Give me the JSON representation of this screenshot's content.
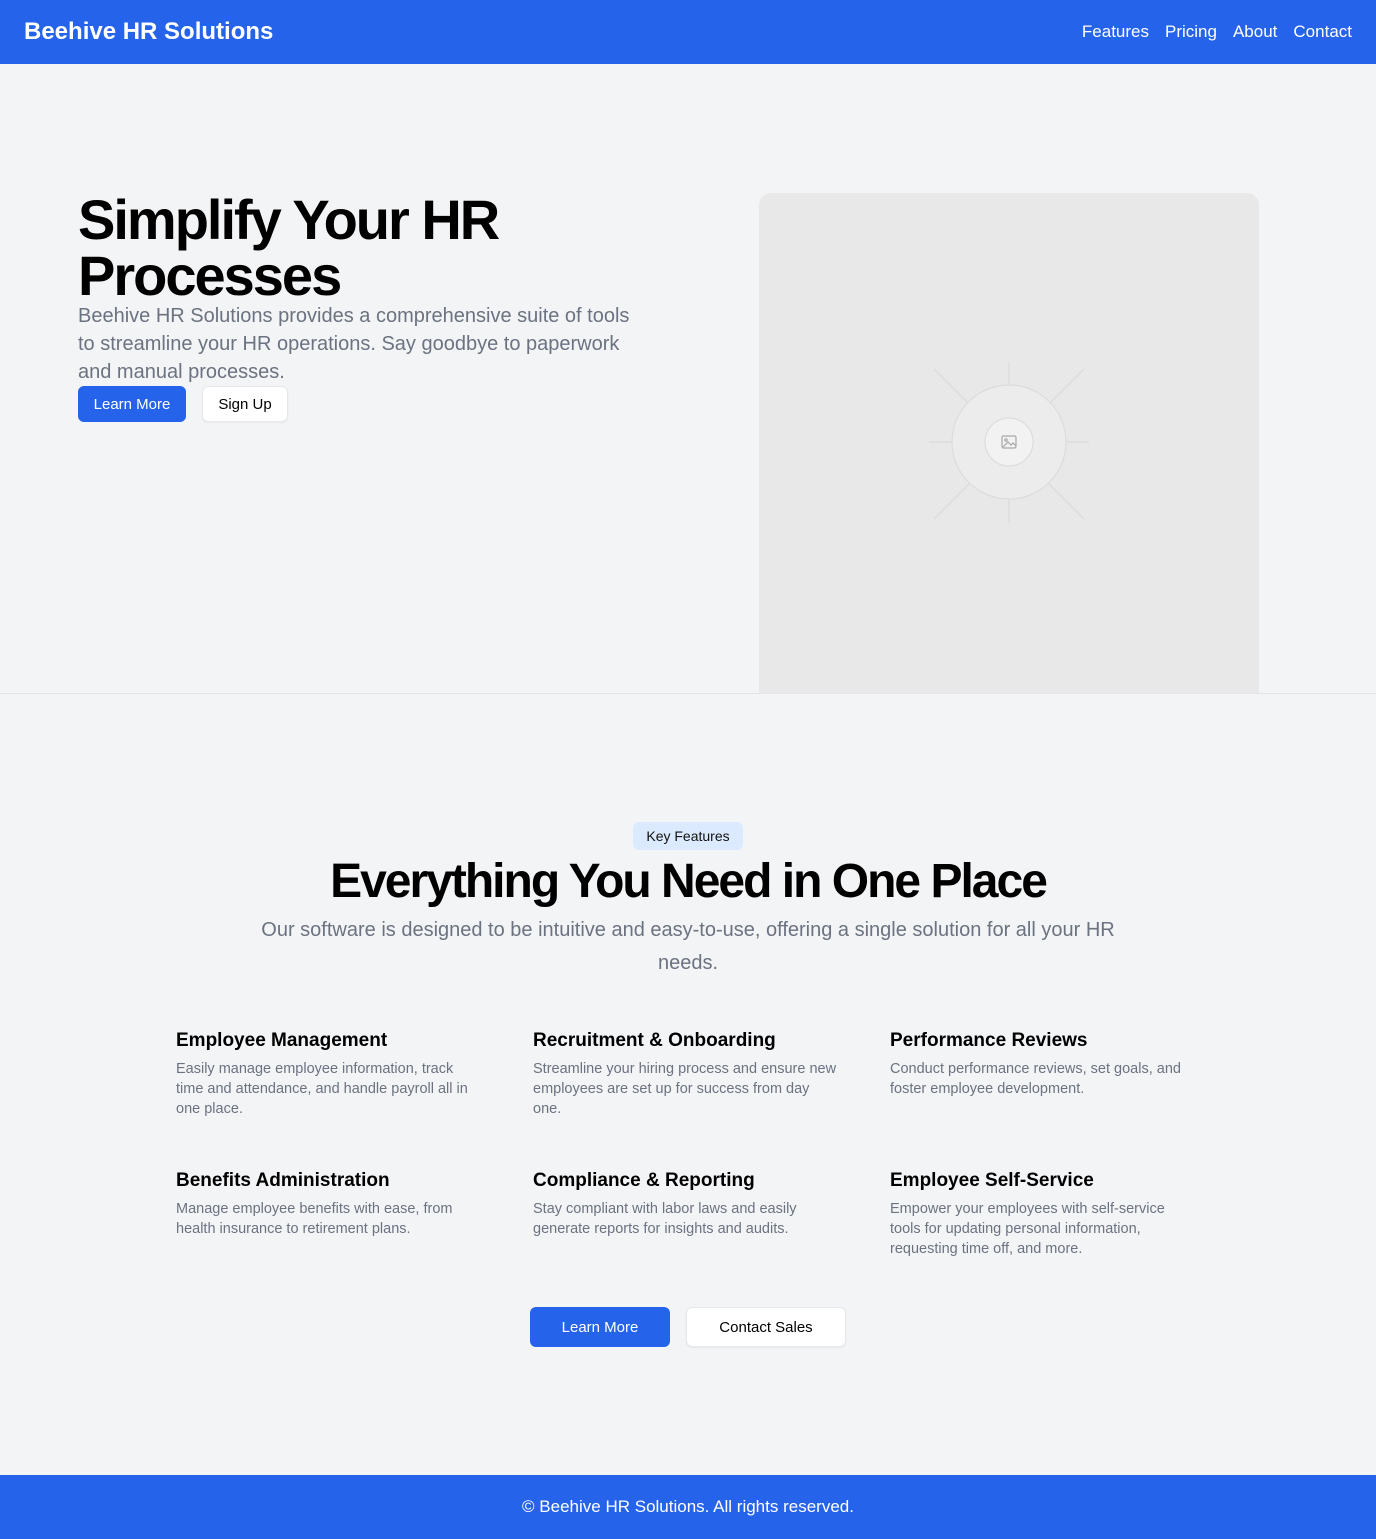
{
  "header": {
    "brand": "Beehive HR Solutions",
    "nav": [
      "Features",
      "Pricing",
      "About",
      "Contact"
    ]
  },
  "hero": {
    "title": "Simplify Your HR Processes",
    "subtitle": "Beehive HR Solutions provides a comprehensive suite of tools to streamline your HR operations. Say goodbye to paperwork and manual processes.",
    "primary_button": "Learn More",
    "secondary_button": "Sign Up",
    "image_icon": "image-placeholder-icon"
  },
  "features_section": {
    "badge": "Key Features",
    "title": "Everything You Need in One Place",
    "subtitle": "Our software is designed to be intuitive and easy-to-use, offering a single solution for all your HR needs.",
    "items": [
      {
        "title": "Employee Management",
        "description": "Easily manage employee information, track time and attendance, and handle payroll all in one place."
      },
      {
        "title": "Recruitment & Onboarding",
        "description": "Streamline your hiring process and ensure new employees are set up for success from day one."
      },
      {
        "title": "Performance Reviews",
        "description": "Conduct performance reviews, set goals, and foster employee development."
      },
      {
        "title": "Benefits Administration",
        "description": "Manage employee benefits with ease, from health insurance to retirement plans."
      },
      {
        "title": "Compliance & Reporting",
        "description": "Stay compliant with labor laws and easily generate reports for insights and audits."
      },
      {
        "title": "Employee Self-Service",
        "description": "Empower your employees with self-service tools for updating personal information, requesting time off, and more."
      }
    ],
    "primary_button": "Learn More",
    "secondary_button": "Contact Sales"
  },
  "footer": {
    "text": "© Beehive HR Solutions. All rights reserved."
  },
  "colors": {
    "brand_blue": "#2563eb",
    "background": "#f3f4f6",
    "badge_bg": "#dbeafe",
    "muted_text": "#6b7280"
  }
}
